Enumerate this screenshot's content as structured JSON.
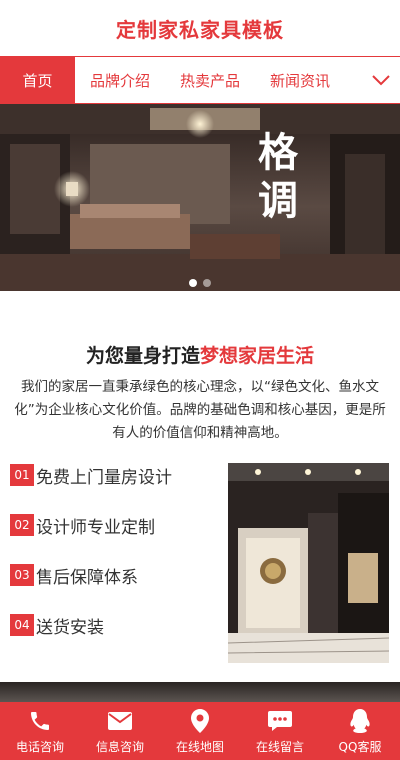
{
  "site": {
    "title": "定制家私家具模板"
  },
  "nav": {
    "items": [
      {
        "label": "首页",
        "active": true
      },
      {
        "label": "品牌介绍"
      },
      {
        "label": "热卖产品"
      },
      {
        "label": "新闻资讯"
      }
    ],
    "toggle_icon": "chevron-down-icon"
  },
  "banner": {
    "heading_chars": [
      "格",
      "调"
    ],
    "slides_total": 2,
    "slide_active": 1
  },
  "intro": {
    "title_prefix": "为您量身打造",
    "title_highlight": "梦想家居生活",
    "text": "我们的家居一直秉承绿色的核心理念，以“绿色文化、鱼水文化”为企业核心文化价值。品牌的基础色调和核心基因，更是所有人的价值信仰和精神高地。"
  },
  "features": [
    {
      "num": "01",
      "text": "免费上门量房设计"
    },
    {
      "num": "02",
      "text": "设计师专业定制"
    },
    {
      "num": "03",
      "text": "售后保障体系"
    },
    {
      "num": "04",
      "text": "送货安装"
    }
  ],
  "bottom_bar": {
    "items": [
      {
        "label": "电话咨询",
        "icon": "phone-icon"
      },
      {
        "label": "信息咨询",
        "icon": "mail-icon"
      },
      {
        "label": "在线地图",
        "icon": "map-pin-icon"
      },
      {
        "label": "在线留言",
        "icon": "chat-icon"
      },
      {
        "label": "QQ客服",
        "icon": "qq-icon"
      }
    ]
  },
  "colors": {
    "accent": "#e4393c",
    "text": "#333333"
  }
}
